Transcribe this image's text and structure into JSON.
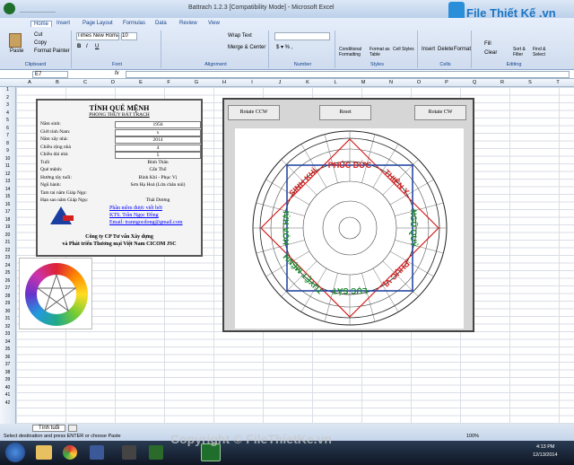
{
  "window": {
    "title": "Battrach 1.2.3  [Compatibility Mode] - Microsoft Excel"
  },
  "ribbon": {
    "tabs": [
      "Home",
      "Insert",
      "Page Layout",
      "Formulas",
      "Data",
      "Review",
      "View"
    ],
    "clipboard": {
      "paste": "Paste",
      "cut": "Cut",
      "copy": "Copy",
      "format_painter": "Format Painter",
      "label": "Clipboard"
    },
    "font": {
      "name": "Times New Roman",
      "size": "10",
      "label": "Font"
    },
    "alignment": {
      "wrap": "Wrap Text",
      "merge": "Merge & Center",
      "label": "Alignment"
    },
    "number": {
      "label": "Number",
      "symbols": "$ ▾ % ,"
    },
    "styles": {
      "cond": "Conditional Formatting",
      "fmt_table": "Format as Table",
      "cell": "Cell Styles",
      "label": "Styles"
    },
    "cells": {
      "insert": "Insert",
      "delete": "Delete",
      "format": "Format",
      "label": "Cells"
    },
    "editing": {
      "fill": "Fill",
      "clear": "Clear",
      "sort": "Sort & Filter",
      "find": "Find & Select",
      "label": "Editing"
    }
  },
  "formula_bar": {
    "name_box": "E7",
    "fx": "fx"
  },
  "columns": [
    "A",
    "B",
    "C",
    "D",
    "E",
    "F",
    "G",
    "H",
    "I",
    "J",
    "K",
    "L",
    "M",
    "N",
    "O",
    "P",
    "Q",
    "R",
    "S",
    "T"
  ],
  "rows": [
    "1",
    "2",
    "3",
    "4",
    "5",
    "6",
    "7",
    "8",
    "9",
    "10",
    "11",
    "12",
    "13",
    "14",
    "15",
    "16",
    "17",
    "18",
    "19",
    "20",
    "21",
    "22",
    "23",
    "24",
    "25",
    "26",
    "27",
    "28",
    "29",
    "30",
    "31",
    "32",
    "33",
    "34",
    "35",
    "36",
    "37",
    "38",
    "39",
    "40",
    "41",
    "42"
  ],
  "info": {
    "title": "TÍNH QUẺ MỆNH",
    "subtitle": "PHONG THỦY BÁT TRẠCH",
    "fields": [
      {
        "label": "Năm sinh:",
        "value": "1956"
      },
      {
        "label": "Giới tính Nam:",
        "value": "x"
      },
      {
        "label": "Năm xây nhà:",
        "value": "2014"
      },
      {
        "label": "Chiều rộng nhà",
        "value": "4"
      },
      {
        "label": "Chiều dài nhà",
        "value": "5"
      },
      {
        "label": "Tuổi",
        "value": "Bính Thân"
      },
      {
        "label": "Quẻ mệnh:",
        "value": "Cấn Thổ"
      },
      {
        "label": "Hướng tây tuổi:",
        "value": "Bình Khí - Phục Vị"
      },
      {
        "label": "Ngũ hành:",
        "value": "Sơn Hạ Hoả (Lửa chân núi)"
      },
      {
        "label": "Tam tai năm Giáp Ngọ:",
        "value": ""
      },
      {
        "label": "Hạn sao năm Giáp Ngọ:",
        "value": "Thái Dương"
      }
    ],
    "links": [
      "Phần mềm được viết bởi",
      "KTS. Trần Ngọc Đông",
      "Email: tranngocdong@gmail.com"
    ],
    "company1": "Công ty CP Tư vấn Xây dựng",
    "company2": "và Phát triển Thương mại Việt Nam CICOM JSC"
  },
  "panel": {
    "rotate_ccw": "Rotate CCW",
    "reset": "Reset",
    "rotate_cw": "Rotate CW",
    "sectors": [
      "PHÚC ĐỨC",
      "THIÊN Y",
      "NGŨ QUỶ",
      "PHỤC VỊ",
      "LỤC SÁT",
      "TUYỆT MỆNH",
      "HỌA HẠI",
      "SINH KHÍ"
    ]
  },
  "sheet_tab": "Tính tuổi",
  "status": {
    "text": "Select destination and press ENTER or choose Paste",
    "zoom": "100%"
  },
  "watermark": {
    "brand": "File Thiết Kế .vn",
    "copyright": "Copyright © FileThietKe.vn"
  },
  "clock": {
    "time": "4:13 PM",
    "date": "12/13/2014"
  },
  "colors": {
    "sector_red": "#d32020",
    "sector_green": "#1a8a2a",
    "frame_blue": "#1a3fa0"
  }
}
